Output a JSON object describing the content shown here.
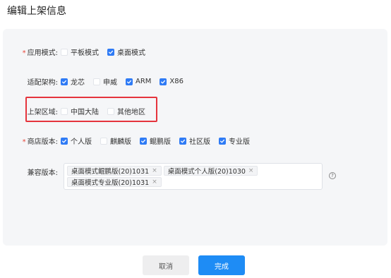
{
  "page": {
    "title": "编辑上架信息"
  },
  "form": {
    "app_mode": {
      "label": "应用模式:",
      "required": true,
      "options": [
        {
          "label": "平板模式",
          "checked": false
        },
        {
          "label": "桌面模式",
          "checked": true
        }
      ]
    },
    "arch": {
      "label": "适配架构:",
      "required": false,
      "options": [
        {
          "label": "龙芯",
          "checked": true
        },
        {
          "label": "申威",
          "checked": false
        },
        {
          "label": "ARM",
          "checked": true
        },
        {
          "label": "X86",
          "checked": true
        }
      ]
    },
    "area": {
      "label": "上架区域:",
      "required": false,
      "options": [
        {
          "label": "中国大陆",
          "checked": false
        },
        {
          "label": "其他地区",
          "checked": false
        }
      ]
    },
    "edition": {
      "label": "商店版本:",
      "required": true,
      "options": [
        {
          "label": "个人版",
          "checked": true
        },
        {
          "label": "麒麟版",
          "checked": false
        },
        {
          "label": "鲲鹏版",
          "checked": true
        },
        {
          "label": "社区版",
          "checked": true
        },
        {
          "label": "专业版",
          "checked": true
        }
      ]
    },
    "compat": {
      "label": "兼容版本:",
      "tags": [
        "桌面模式鲲鹏版(20)1031",
        "桌面模式个人版(20)1030",
        "桌面模式专业版(20)1031"
      ],
      "tag_remove": "×"
    },
    "required_mark": "*"
  },
  "footer": {
    "cancel_label": "取消",
    "done_label": "完成"
  },
  "help_icon_glyph": "?",
  "colors": {
    "accent": "#2f7bf5",
    "primary_button": "#1e8cf5",
    "highlight": "#e5343d",
    "required": "#e8473b"
  }
}
